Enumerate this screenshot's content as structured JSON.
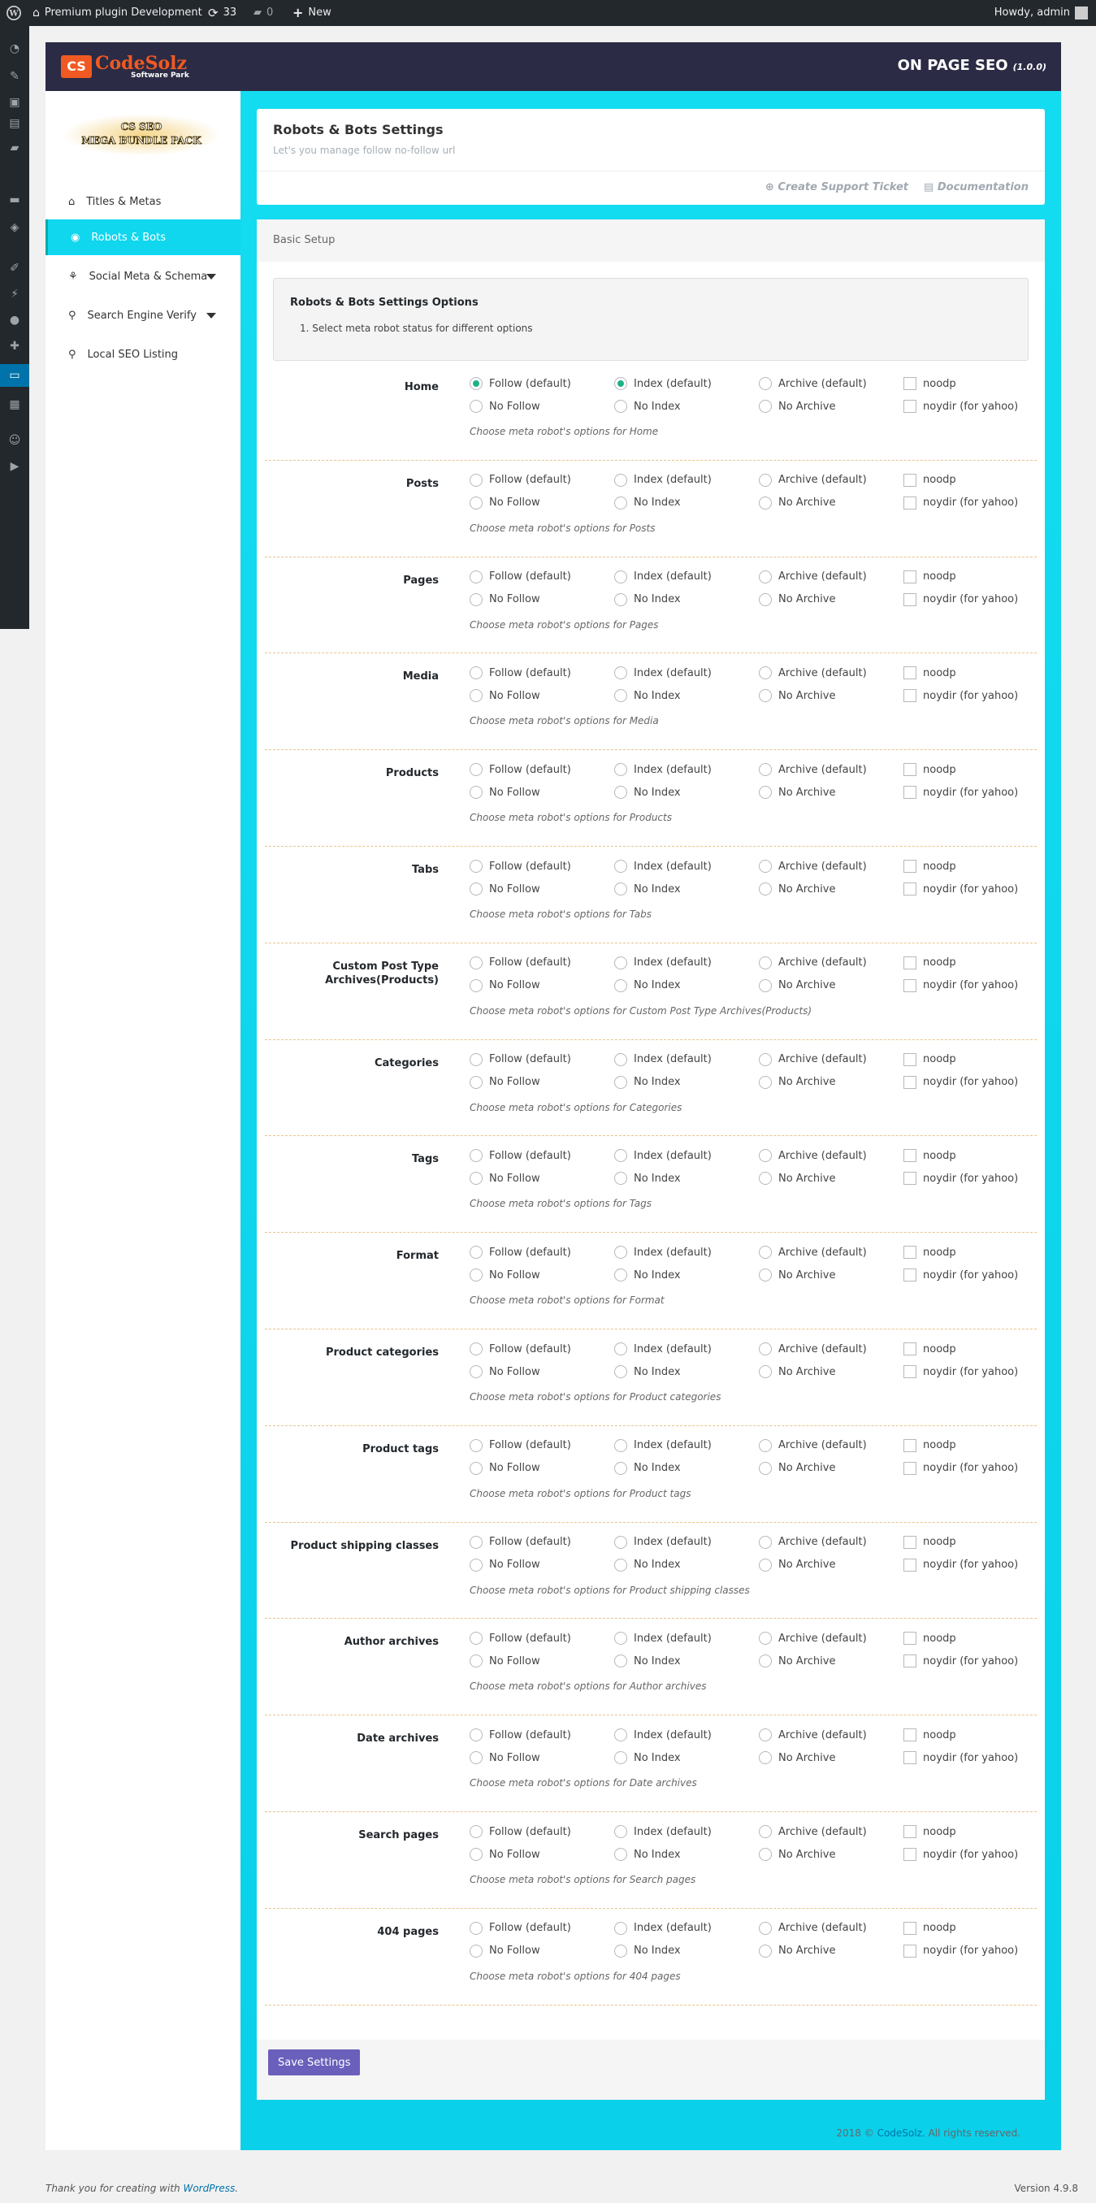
{
  "adminbar": {
    "site_name": "Premium plugin Development",
    "updates_count": "33",
    "comments_count": "0",
    "new_label": "New",
    "howdy": "Howdy, admin"
  },
  "plugin": {
    "logo_text": "CodeSolz",
    "logo_mark": "CS",
    "logo_sub": "Software Park",
    "title": "ON PAGE SEO",
    "version": "(1.0.0)"
  },
  "sidebar": {
    "bundle_line1": "CS SEO",
    "bundle_line2": "MEGA BUNDLE PACK",
    "items": [
      {
        "label": "Titles & Metas"
      },
      {
        "label": "Robots & Bots"
      },
      {
        "label": "Social Meta & Schema"
      },
      {
        "label": "Search Engine Verify"
      },
      {
        "label": "Local SEO Listing"
      }
    ]
  },
  "header_box": {
    "title": "Robots & Bots Settings",
    "description": "Let's you manage follow no-follow url",
    "support_link": "Create Support Ticket",
    "docs_link": "Documentation"
  },
  "basic_setup": {
    "header": "Basic Setup",
    "info_title": "Robots & Bots Settings Options",
    "info_item": "1. Select meta robot status for different options"
  },
  "option_labels": {
    "follow": "Follow (default)",
    "nofollow": "No Follow",
    "index": "Index (default)",
    "noindex": "No Index",
    "archive": "Archive (default)",
    "noarchive": "No Archive",
    "noodp": "noodp",
    "noydir": "noydir (for yahoo)"
  },
  "rows": [
    {
      "label": "Home",
      "help": "Choose meta robot's options for Home",
      "follow_checked": true,
      "index_checked": true
    },
    {
      "label": "Posts",
      "help": "Choose meta robot's options for Posts"
    },
    {
      "label": "Pages",
      "help": "Choose meta robot's options for Pages"
    },
    {
      "label": "Media",
      "help": "Choose meta robot's options for Media"
    },
    {
      "label": "Products",
      "help": "Choose meta robot's options for Products"
    },
    {
      "label": "Tabs",
      "help": "Choose meta robot's options for Tabs"
    },
    {
      "label": "Custom Post Type Archives(Products)",
      "help": "Choose meta robot's options for Custom Post Type Archives(Products)"
    },
    {
      "label": "Categories",
      "help": "Choose meta robot's options for Categories"
    },
    {
      "label": "Tags",
      "help": "Choose meta robot's options for Tags"
    },
    {
      "label": "Format",
      "help": "Choose meta robot's options for Format"
    },
    {
      "label": "Product categories",
      "help": "Choose meta robot's options for Product categories"
    },
    {
      "label": "Product tags",
      "help": "Choose meta robot's options for Product tags"
    },
    {
      "label": "Product shipping classes",
      "help": "Choose meta robot's options for Product shipping classes"
    },
    {
      "label": "Author archives",
      "help": "Choose meta robot's options for Author archives"
    },
    {
      "label": "Date archives",
      "help": "Choose meta robot's options for Date archives"
    },
    {
      "label": "Search pages",
      "help": "Choose meta robot's options for Search pages"
    },
    {
      "label": "404 pages",
      "help": "Choose meta robot's options for 404 pages"
    }
  ],
  "save_label": "Save Settings",
  "footer": {
    "year": "2018 ©",
    "company": "CodeSolz",
    "rights": ". All rights reserved."
  },
  "wp_footer": {
    "thanks": "Thank you for creating with",
    "wp_link": "WordPress",
    "dot": ".",
    "version": "Version 4.9.8"
  },
  "colors": {
    "accent": "#10d6ee",
    "header": "#2b2b45",
    "brand": "#f05a22",
    "save": "#6a5fbb",
    "radio_checked": "#1fb186"
  }
}
